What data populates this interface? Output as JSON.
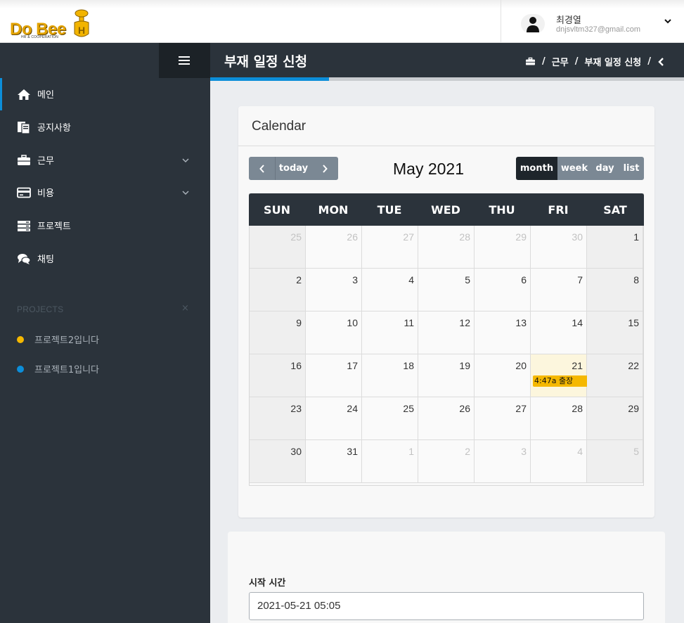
{
  "logo": {
    "text": "Do Bee",
    "subtitle": "HR & COOPERATION"
  },
  "user": {
    "name": "최경열",
    "email": "dnjsvltm327@gmail.com",
    "avatar_icon": "user-icon",
    "menu_icon": "chevron-down-icon"
  },
  "sidebar": {
    "items": [
      {
        "label": "메인",
        "icon": "home-icon",
        "active": true,
        "has_submenu": false
      },
      {
        "label": "공지사항",
        "icon": "document-icon",
        "active": false,
        "has_submenu": false
      },
      {
        "label": "근무",
        "icon": "briefcase-icon",
        "active": false,
        "has_submenu": true
      },
      {
        "label": "비용",
        "icon": "credit-card-icon",
        "active": false,
        "has_submenu": true
      },
      {
        "label": "프로젝트",
        "icon": "server-icon",
        "active": false,
        "has_submenu": false
      },
      {
        "label": "채팅",
        "icon": "comments-icon",
        "active": false,
        "has_submenu": false
      }
    ],
    "projects_title": "PROJECTS",
    "projects_close": "×",
    "projects": [
      {
        "label": "프로젝트2입니다",
        "color": "#f5b800"
      },
      {
        "label": "프로젝트1입니다",
        "color": "#0c8ed9"
      }
    ]
  },
  "page": {
    "title": "부재 일정 신청",
    "progress": 0.25,
    "breadcrumb": [
      "근무",
      "부재 일정 신청"
    ],
    "breadcrumb_sep": "/",
    "breadcrumb_home_icon": "briefcase-icon"
  },
  "calendar": {
    "card_title": "Calendar",
    "today_label": "today",
    "month_title": "May 2021",
    "views": [
      "month",
      "week",
      "day",
      "list"
    ],
    "active_view": "month",
    "dow": [
      "SUN",
      "MON",
      "TUE",
      "WED",
      "THU",
      "FRI",
      "SAT"
    ],
    "weeks": [
      [
        {
          "d": "25",
          "o": true
        },
        {
          "d": "26",
          "o": true
        },
        {
          "d": "27",
          "o": true
        },
        {
          "d": "28",
          "o": true
        },
        {
          "d": "29",
          "o": true
        },
        {
          "d": "30",
          "o": true
        },
        {
          "d": "1",
          "o": false
        }
      ],
      [
        {
          "d": "2",
          "o": false
        },
        {
          "d": "3",
          "o": false
        },
        {
          "d": "4",
          "o": false
        },
        {
          "d": "5",
          "o": false
        },
        {
          "d": "6",
          "o": false
        },
        {
          "d": "7",
          "o": false
        },
        {
          "d": "8",
          "o": false
        }
      ],
      [
        {
          "d": "9",
          "o": false
        },
        {
          "d": "10",
          "o": false
        },
        {
          "d": "11",
          "o": false
        },
        {
          "d": "12",
          "o": false
        },
        {
          "d": "13",
          "o": false
        },
        {
          "d": "14",
          "o": false
        },
        {
          "d": "15",
          "o": false
        }
      ],
      [
        {
          "d": "16",
          "o": false
        },
        {
          "d": "17",
          "o": false
        },
        {
          "d": "18",
          "o": false
        },
        {
          "d": "19",
          "o": false
        },
        {
          "d": "20",
          "o": false
        },
        {
          "d": "21",
          "o": false,
          "today": true
        },
        {
          "d": "22",
          "o": false
        }
      ],
      [
        {
          "d": "23",
          "o": false
        },
        {
          "d": "24",
          "o": false
        },
        {
          "d": "25",
          "o": false
        },
        {
          "d": "26",
          "o": false
        },
        {
          "d": "27",
          "o": false
        },
        {
          "d": "28",
          "o": false
        },
        {
          "d": "29",
          "o": false
        }
      ],
      [
        {
          "d": "30",
          "o": false
        },
        {
          "d": "31",
          "o": false
        },
        {
          "d": "1",
          "o": true
        },
        {
          "d": "2",
          "o": true
        },
        {
          "d": "3",
          "o": true
        },
        {
          "d": "4",
          "o": true
        },
        {
          "d": "5",
          "o": true
        }
      ]
    ],
    "events": [
      {
        "date": "2021-05-21",
        "label": "4:47a 출장",
        "color": "#f5b800"
      }
    ]
  },
  "form": {
    "start_label": "시작 시간",
    "start_value": "2021-05-21 05:05"
  },
  "colors": {
    "accent": "#0c8ed9",
    "sidebar": "#2b333b",
    "event": "#f5b800"
  }
}
